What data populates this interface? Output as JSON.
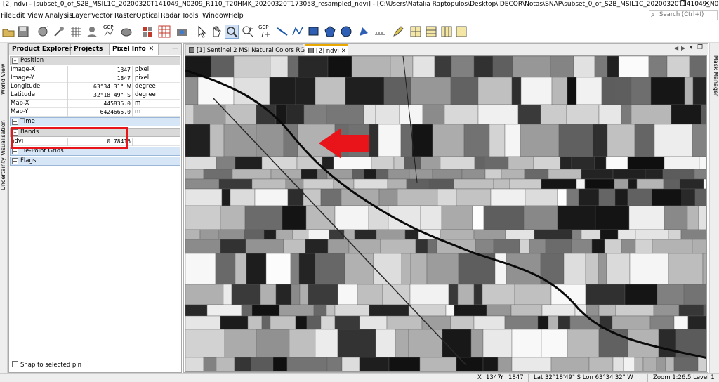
{
  "window": {
    "title": "[2] ndvi - [subset_0_of_S2B_MSIL1C_20200320T141049_N0209_R110_T20HMK_20200320T173058_resampled_ndvi] - [C:\\Users\\Natalia Raptopulos\\Desktop\\IDECOR\\Notas\\SNAP\\subset_0_of_S2B_MSIL1C_20200320T141049_N0209_...",
    "minimize": "–",
    "maximize": "❐",
    "close": "✕"
  },
  "menu": {
    "items": [
      "File",
      "Edit",
      "View",
      "Analysis",
      "Layer",
      "Vector",
      "Raster",
      "Optical",
      "Radar",
      "Tools",
      "Window",
      "Help"
    ],
    "search_placeholder": "Search (Ctrl+I)"
  },
  "toolbar": {
    "gcp_label_1": "GCP",
    "gcp_label_2": "GCP"
  },
  "left_strip": {
    "world_view": "World View",
    "uncertainty": "Uncertainty Visualisation"
  },
  "left_panel": {
    "tabs": [
      {
        "label": "Product Explorer"
      },
      {
        "label": "Projects"
      },
      {
        "label": "Pixel Info",
        "close": "✕"
      }
    ],
    "minimize": "—",
    "position": {
      "header": "Position",
      "rows": [
        {
          "label": "Image-X",
          "value": "1347",
          "unit": "pixel"
        },
        {
          "label": "Image-Y",
          "value": "1847",
          "unit": "pixel"
        },
        {
          "label": "Longitude",
          "value": "63°34'31\" W",
          "unit": "degree"
        },
        {
          "label": "Latitude",
          "value": "32°18'49\" S",
          "unit": "degree"
        },
        {
          "label": "Map-X",
          "value": "445835.0",
          "unit": "m"
        },
        {
          "label": "Map-Y",
          "value": "6424665.0",
          "unit": "m"
        }
      ]
    },
    "time": {
      "header": "Time"
    },
    "bands": {
      "header": "Bands",
      "rows": [
        {
          "label": "ndvi",
          "value": "0.78416",
          "unit": ""
        }
      ]
    },
    "tie_point_grids": {
      "header": "Tie-Point Grids"
    },
    "flags": {
      "header": "Flags"
    },
    "snap_label": "Snap to selected pin"
  },
  "image_view": {
    "tabs": [
      {
        "label": "[1] Sentinel 2 MSI Natural Colors RGB",
        "close": "✕"
      },
      {
        "label": "[2] ndvi",
        "close": "✕"
      }
    ],
    "nav_left": "◀",
    "nav_right": "▶",
    "nav_menu": "▾",
    "nav_restore": "❐"
  },
  "right_strip": {
    "label": "Mask Manager"
  },
  "status": {
    "x_label": "X",
    "x_value": "1347",
    "y_label": "Y",
    "y_value": "1847",
    "latlon": "Lat 32°18'49\" S  Lon 63°34'32\" W",
    "zoom": "Zoom 1:26.5  Level 1"
  },
  "colors": {
    "annotation_red": "#e8141a",
    "accent_blue": "#d7e6f6",
    "active_tab_orange": "#e8a800"
  }
}
